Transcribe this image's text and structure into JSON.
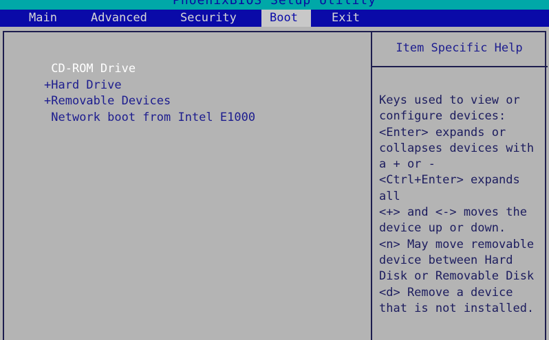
{
  "window": {
    "title": "PhoenixBIOS Setup Utility"
  },
  "menu": [
    {
      "label": "Main"
    },
    {
      "label": "Advanced"
    },
    {
      "label": "Security"
    },
    {
      "label": "Boot"
    },
    {
      "label": "Exit"
    }
  ],
  "active_tab": "Boot",
  "boot_items": [
    {
      "marker": " ",
      "label": "CD-ROM Drive",
      "selected": true
    },
    {
      "marker": "+",
      "label": "Hard Drive",
      "selected": false
    },
    {
      "marker": "+",
      "label": "Removable Devices",
      "selected": false
    },
    {
      "marker": " ",
      "label": "Network boot from Intel E1000",
      "selected": false
    }
  ],
  "help": {
    "title": "Item Specific Help",
    "lines": [
      "Keys used to view or",
      "configure devices:",
      "<Enter> expands or",
      "collapses devices with",
      "a + or -",
      "<Ctrl+Enter> expands",
      "all",
      "<+> and <-> moves the",
      "device up or down.",
      "<n> May move removable",
      "device between Hard",
      "Disk or Removable Disk",
      "<d> Remove a device",
      "that is not installed."
    ]
  },
  "colors": {
    "title_bar": "#00a8a8",
    "menu_bar": "#0a0aa8",
    "background": "#b4b4b4",
    "text": "#1c1c8e",
    "selected_text": "#ffffff"
  }
}
